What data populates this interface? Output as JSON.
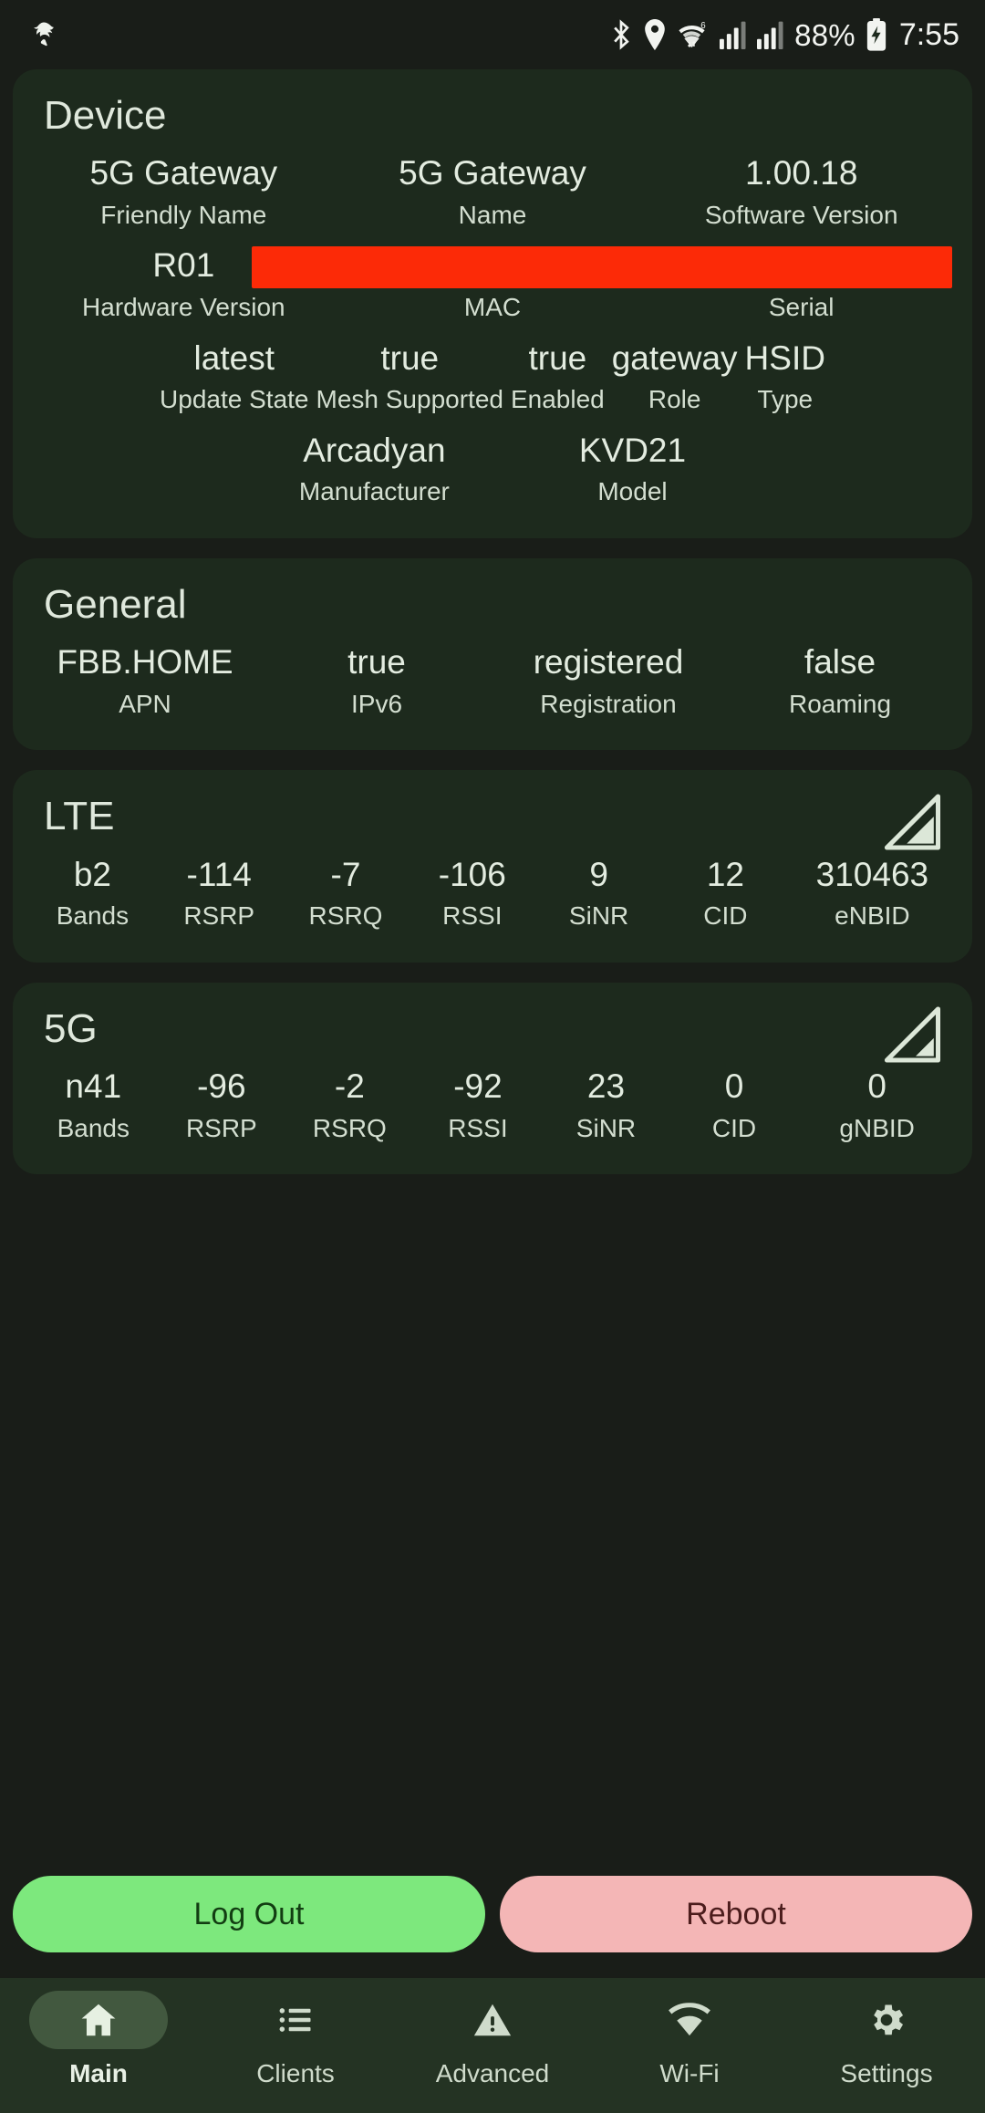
{
  "statusbar": {
    "icons_left": [
      "app-notification-icon"
    ],
    "icons_right": [
      "bluetooth-icon",
      "location-icon",
      "wifi-icon",
      "signal-bars-icon-1",
      "signal-bars-icon-2"
    ],
    "battery_percent": "88%",
    "battery_icon": "battery-charging-icon",
    "time": "7:55"
  },
  "cards": {
    "device": {
      "title": "Device",
      "row1": [
        {
          "value": "5G Gateway",
          "label": "Friendly Name"
        },
        {
          "value": "5G Gateway",
          "label": "Name"
        },
        {
          "value": "1.00.18",
          "label": "Software Version"
        }
      ],
      "row2": [
        {
          "value": "R01",
          "label": "Hardware Version"
        },
        {
          "value": "",
          "label": "MAC"
        },
        {
          "value": "",
          "label": "Serial"
        }
      ],
      "redaction_color": "#fc2a07",
      "row3": [
        {
          "value": "latest",
          "label": "Update State"
        },
        {
          "value": "true",
          "label": "Mesh Supported"
        },
        {
          "value": "true",
          "label": "Enabled"
        },
        {
          "value": "gateway",
          "label": "Role"
        },
        {
          "value": "HSID",
          "label": "Type"
        }
      ],
      "row4": [
        {
          "value": "Arcadyan",
          "label": "Manufacturer"
        },
        {
          "value": "KVD21",
          "label": "Model"
        }
      ]
    },
    "general": {
      "title": "General",
      "row1": [
        {
          "value": "FBB.HOME",
          "label": "APN"
        },
        {
          "value": "true",
          "label": "IPv6"
        },
        {
          "value": "registered",
          "label": "Registration"
        },
        {
          "value": "false",
          "label": "Roaming"
        }
      ]
    },
    "lte": {
      "title": "LTE",
      "signal_icon": "signal-strength-icon",
      "signal_level": 3,
      "row1": [
        {
          "value": "b2",
          "label": "Bands"
        },
        {
          "value": "-114",
          "label": "RSRP"
        },
        {
          "value": "-7",
          "label": "RSRQ"
        },
        {
          "value": "-106",
          "label": "RSSI"
        },
        {
          "value": "9",
          "label": "SiNR"
        },
        {
          "value": "12",
          "label": "CID"
        },
        {
          "value": "310463",
          "label": "eNBID"
        }
      ]
    },
    "fiveg": {
      "title": "5G",
      "signal_icon": "signal-strength-icon",
      "signal_level": 2,
      "row1": [
        {
          "value": "n41",
          "label": "Bands"
        },
        {
          "value": "-96",
          "label": "RSRP"
        },
        {
          "value": "-2",
          "label": "RSRQ"
        },
        {
          "value": "-92",
          "label": "RSSI"
        },
        {
          "value": "23",
          "label": "SiNR"
        },
        {
          "value": "0",
          "label": "CID"
        },
        {
          "value": "0",
          "label": "gNBID"
        }
      ]
    }
  },
  "actions": {
    "logout_label": "Log Out",
    "logout_color": "#7de87d",
    "reboot_label": "Reboot",
    "reboot_color": "#f4b6b6"
  },
  "nav": {
    "items": [
      {
        "label": "Main",
        "icon": "home-icon",
        "active": true
      },
      {
        "label": "Clients",
        "icon": "list-icon",
        "active": false
      },
      {
        "label": "Advanced",
        "icon": "warning-triangle-icon",
        "active": false
      },
      {
        "label": "Wi-Fi",
        "icon": "wifi-icon",
        "active": false
      },
      {
        "label": "Settings",
        "icon": "gear-icon",
        "active": false
      }
    ]
  }
}
